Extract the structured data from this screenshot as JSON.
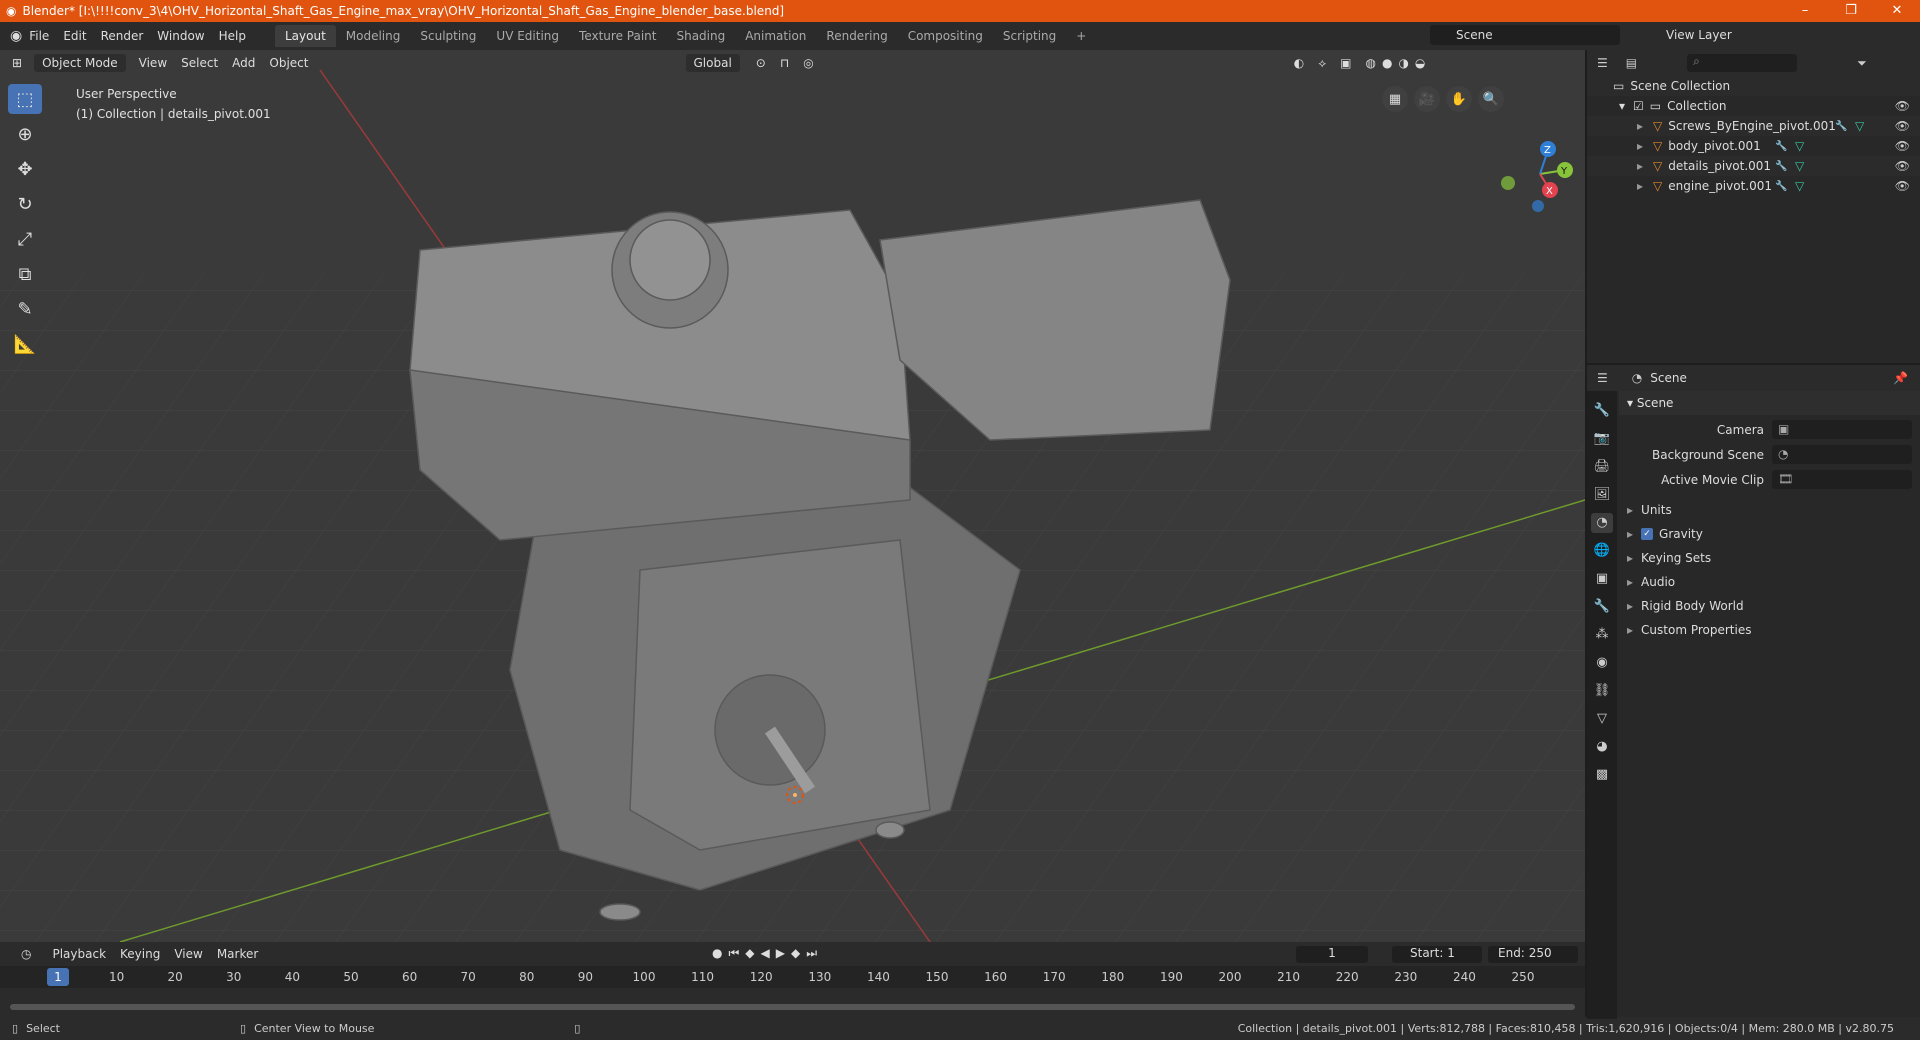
{
  "window": {
    "title": "Blender* [I:\\!!!!conv_3\\4\\OHV_Horizontal_Shaft_Gas_Engine_max_vray\\OHV_Horizontal_Shaft_Gas_Engine_blender_base.blend]",
    "minimize": "–",
    "maximize": "❐",
    "close": "✕"
  },
  "topbar": {
    "menus": [
      "File",
      "Edit",
      "Render",
      "Window",
      "Help"
    ],
    "workspaces": [
      "Layout",
      "Modeling",
      "Sculpting",
      "UV Editing",
      "Texture Paint",
      "Shading",
      "Animation",
      "Rendering",
      "Compositing",
      "Scripting",
      "+"
    ],
    "active_workspace": "Layout",
    "scene": "Scene",
    "view_layer": "View Layer"
  },
  "viewport": {
    "mode": "Object Mode",
    "menus": [
      "View",
      "Select",
      "Add",
      "Object"
    ],
    "transform": "Global",
    "overlay_line1": "User Perspective",
    "overlay_line2": "(1) Collection | details_pivot.001",
    "gizmo": {
      "x": "X",
      "y": "Y",
      "z": "Z"
    }
  },
  "timeline": {
    "menus": [
      "Playback",
      "Keying",
      "View",
      "Marker"
    ],
    "current_frame": "1",
    "start": "Start:",
    "start_val": "1",
    "end": "End:",
    "end_val": "250",
    "ticks": [
      "10",
      "20",
      "30",
      "40",
      "50",
      "60",
      "70",
      "80",
      "90",
      "100",
      "110",
      "120",
      "130",
      "140",
      "150",
      "160",
      "170",
      "180",
      "190",
      "200",
      "210",
      "220",
      "230",
      "240",
      "250"
    ]
  },
  "status": {
    "select": "Select",
    "center": "Center View to Mouse",
    "stats": "Collection | details_pivot.001 | Verts:812,788 | Faces:810,458 | Tris:1,620,916 | Objects:0/4 | Mem: 280.0 MB | v2.80.75"
  },
  "outliner": {
    "root": "Scene Collection",
    "collection": "Collection",
    "objects": [
      "Screws_ByEngine_pivot.001",
      "body_pivot.001",
      "details_pivot.001",
      "engine_pivot.001"
    ]
  },
  "properties": {
    "context": "Scene",
    "panel": "Scene",
    "camera": "Camera",
    "background_scene": "Background Scene",
    "active_movie_clip": "Active Movie Clip",
    "sections": [
      "Units",
      "Gravity",
      "Keying Sets",
      "Audio",
      "Rigid Body World",
      "Custom Properties"
    ]
  },
  "colors": {
    "accent": "#4772b3",
    "titlebar": "#e0540f",
    "x_axis": "#e2434f",
    "y_axis": "#88c43a",
    "z_axis": "#2f7fd6"
  }
}
